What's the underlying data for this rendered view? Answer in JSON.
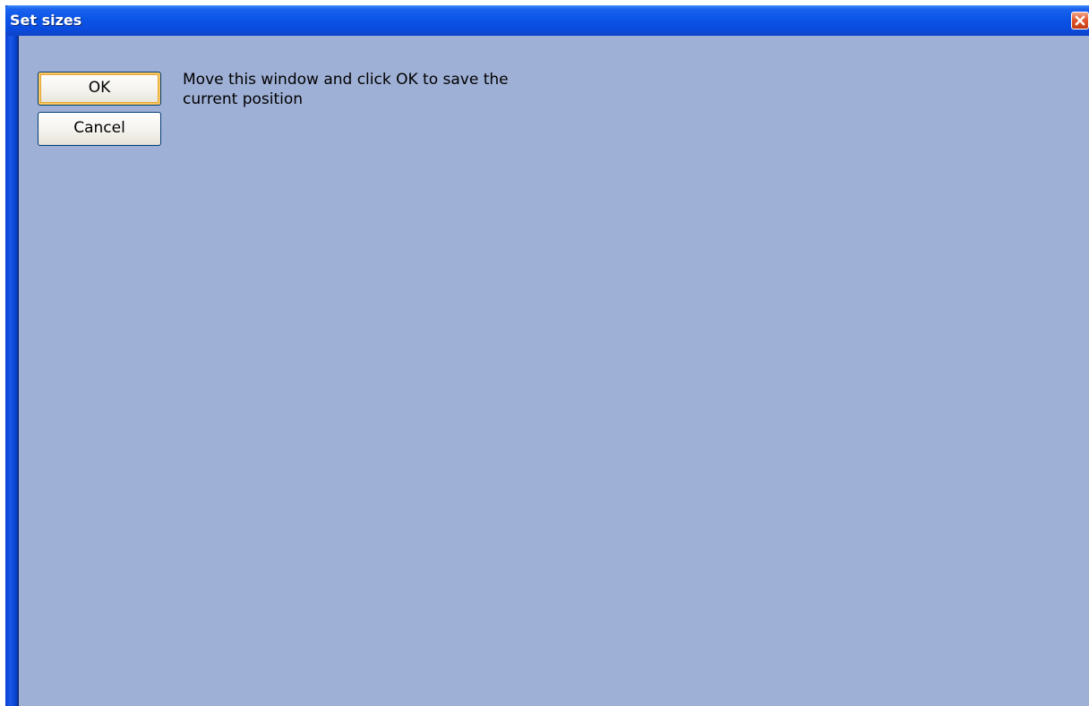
{
  "window": {
    "title": "Set sizes",
    "close_icon": "close-icon"
  },
  "buttons": {
    "ok_label": "OK",
    "cancel_label": "Cancel"
  },
  "message": {
    "text": "Move this window and click OK to save the current position"
  },
  "colors": {
    "titlebar": "#0b55e6",
    "client_background": "#9fb0d6",
    "close_button": "#e2582e"
  }
}
